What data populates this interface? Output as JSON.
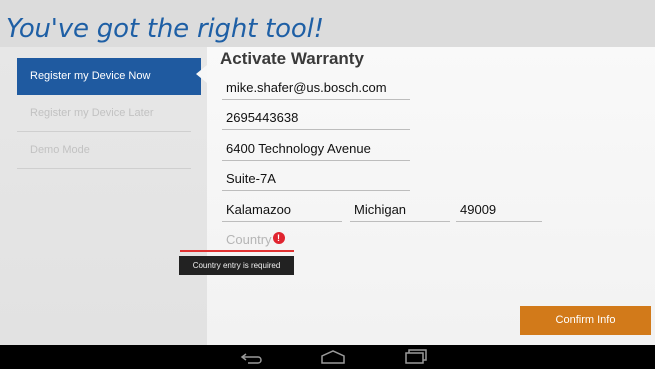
{
  "header": {
    "title": "You've got the right tool!"
  },
  "sidebar": {
    "items": [
      {
        "label": "Register my Device Now"
      },
      {
        "label": "Register my Device Later"
      },
      {
        "label": "Demo Mode"
      }
    ]
  },
  "form": {
    "title": "Activate Warranty",
    "email": "mike.shafer@us.bosch.com",
    "phone": "2695443638",
    "address1": "6400 Technology Avenue",
    "address2": "Suite-7A",
    "city": "Kalamazoo",
    "state": "Michigan",
    "zip": "49009",
    "country_placeholder": "Country",
    "country_error_icon": "!",
    "country_error": "Country entry is required",
    "confirm_label": "Confirm Info"
  },
  "colors": {
    "brand_blue": "#1f5aa0",
    "confirm_orange": "#d27a1a",
    "error_red": "#e0242f"
  },
  "icons": [
    "back-icon",
    "home-icon",
    "recent-apps-icon",
    "error-icon"
  ]
}
